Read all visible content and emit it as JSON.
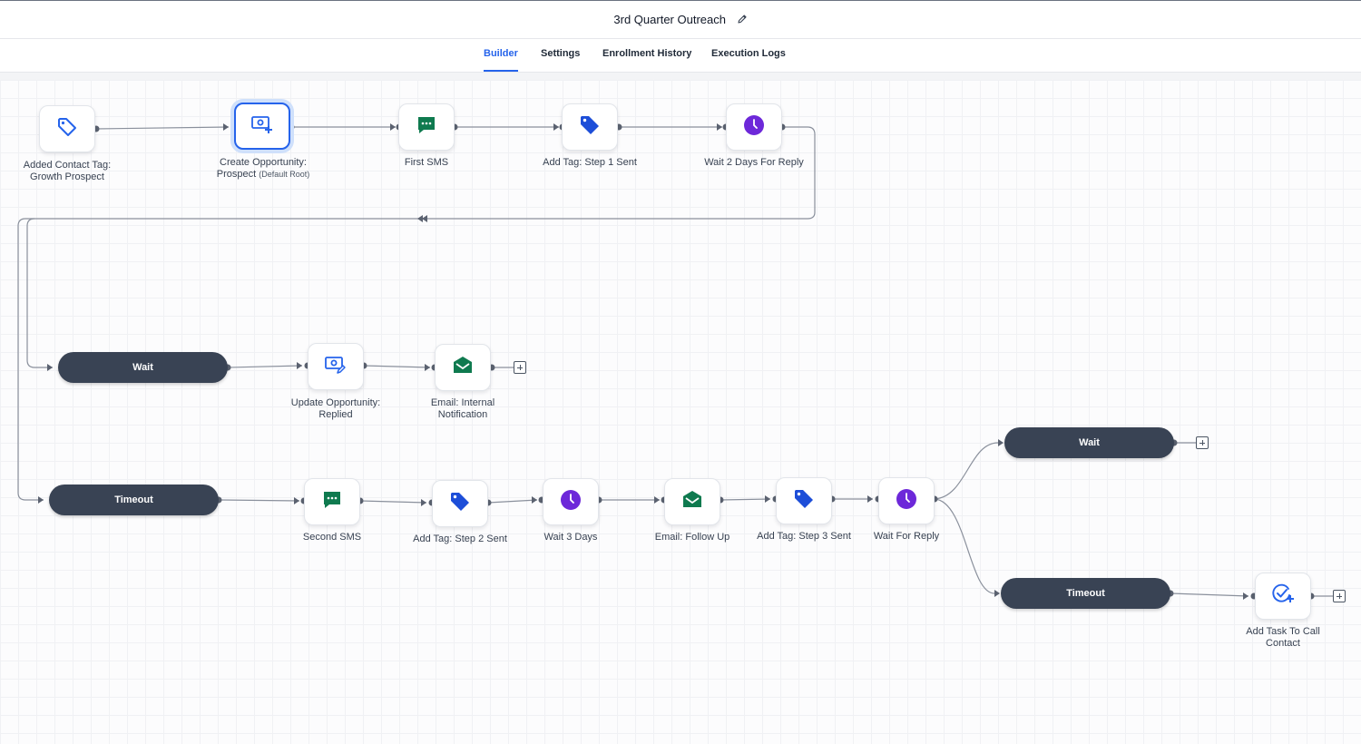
{
  "header": {
    "title": "3rd Quarter Outreach"
  },
  "tabs": [
    {
      "label": "Builder",
      "active": true
    },
    {
      "label": "Settings"
    },
    {
      "label": "Enrollment History"
    },
    {
      "label": "Execution Logs"
    }
  ],
  "nodes": {
    "trigger": {
      "line1": "Added Contact Tag:",
      "line2": "Growth Prospect",
      "icon": "tag-outline-icon"
    },
    "create_opp": {
      "line1": "Create Opportunity:",
      "line2": "Prospect",
      "note": "(Default Root)",
      "icon": "opportunity-add-icon"
    },
    "first_sms": {
      "label": "First SMS",
      "icon": "sms-icon"
    },
    "tag_step1": {
      "label": "Add Tag: Step 1 Sent",
      "icon": "tag-icon"
    },
    "wait_2days": {
      "label": "Wait 2 Days For Reply",
      "icon": "clock-icon"
    },
    "update_opp": {
      "line1": "Update Opportunity:",
      "line2": "Replied",
      "icon": "opportunity-edit-icon"
    },
    "email_internal": {
      "line1": "Email: Internal",
      "line2": "Notification",
      "icon": "email-icon"
    },
    "second_sms": {
      "label": "Second SMS",
      "icon": "sms-icon"
    },
    "tag_step2": {
      "label": "Add Tag: Step 2 Sent",
      "icon": "tag-icon"
    },
    "wait_3days": {
      "label": "Wait 3 Days",
      "icon": "clock-icon"
    },
    "email_follow": {
      "label": "Email: Follow Up",
      "icon": "email-icon"
    },
    "tag_step3": {
      "label": "Add Tag: Step 3 Sent",
      "icon": "tag-icon"
    },
    "wait_reply": {
      "label": "Wait For Reply",
      "icon": "clock-icon"
    },
    "add_task": {
      "line1": "Add Task To Call",
      "line2": "Contact",
      "icon": "task-add-icon"
    }
  },
  "branches": {
    "wait_1": "Wait",
    "timeout_1": "Timeout",
    "wait_2": "Wait",
    "timeout_2": "Timeout"
  },
  "colors": {
    "accent": "#2563eb",
    "sms": "#0f7a4f",
    "email": "#0f7a4f",
    "tag": "#1d4ed8",
    "clock": "#6d28d9",
    "pill": "#394354",
    "connector": "#8a909c"
  }
}
